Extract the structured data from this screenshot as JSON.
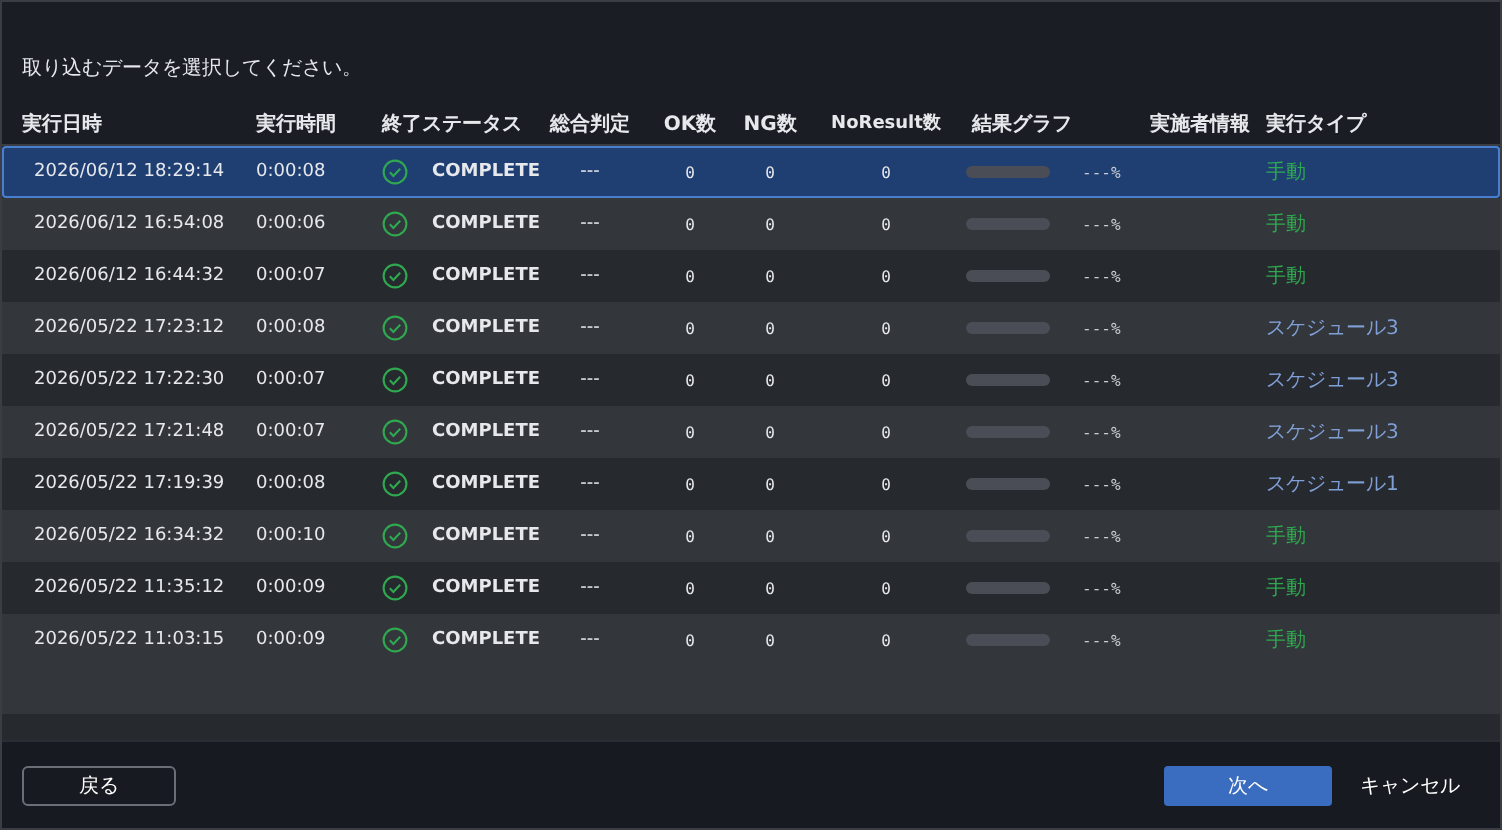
{
  "prompt": "取り込むデータを選択してください。",
  "columns": [
    "実行日時",
    "実行時間",
    "終了ステータス",
    "総合判定",
    "OK数",
    "NG数",
    "NoResult数",
    "結果グラフ",
    "実施者情報",
    "実行タイプ"
  ],
  "rows": [
    {
      "date": "2026/06/12 18:29:14",
      "time": "0:00:08",
      "status": "COMPLETE",
      "total": "---",
      "ok": "0",
      "ng": "0",
      "noresult": "0",
      "percent": "---%",
      "type": "手動",
      "kind": "manual",
      "selected": true
    },
    {
      "date": "2026/06/12 16:54:08",
      "time": "0:00:06",
      "status": "COMPLETE",
      "total": "---",
      "ok": "0",
      "ng": "0",
      "noresult": "0",
      "percent": "---%",
      "type": "手動",
      "kind": "manual",
      "selected": false
    },
    {
      "date": "2026/06/12 16:44:32",
      "time": "0:00:07",
      "status": "COMPLETE",
      "total": "---",
      "ok": "0",
      "ng": "0",
      "noresult": "0",
      "percent": "---%",
      "type": "手動",
      "kind": "manual",
      "selected": false
    },
    {
      "date": "2026/05/22 17:23:12",
      "time": "0:00:08",
      "status": "COMPLETE",
      "total": "---",
      "ok": "0",
      "ng": "0",
      "noresult": "0",
      "percent": "---%",
      "type": "スケジュール3",
      "kind": "schedule",
      "selected": false
    },
    {
      "date": "2026/05/22 17:22:30",
      "time": "0:00:07",
      "status": "COMPLETE",
      "total": "---",
      "ok": "0",
      "ng": "0",
      "noresult": "0",
      "percent": "---%",
      "type": "スケジュール3",
      "kind": "schedule",
      "selected": false
    },
    {
      "date": "2026/05/22 17:21:48",
      "time": "0:00:07",
      "status": "COMPLETE",
      "total": "---",
      "ok": "0",
      "ng": "0",
      "noresult": "0",
      "percent": "---%",
      "type": "スケジュール3",
      "kind": "schedule",
      "selected": false
    },
    {
      "date": "2026/05/22 17:19:39",
      "time": "0:00:08",
      "status": "COMPLETE",
      "total": "---",
      "ok": "0",
      "ng": "0",
      "noresult": "0",
      "percent": "---%",
      "type": "スケジュール1",
      "kind": "schedule",
      "selected": false
    },
    {
      "date": "2026/05/22 16:34:32",
      "time": "0:00:10",
      "status": "COMPLETE",
      "total": "---",
      "ok": "0",
      "ng": "0",
      "noresult": "0",
      "percent": "---%",
      "type": "手動",
      "kind": "manual",
      "selected": false
    },
    {
      "date": "2026/05/22 11:35:12",
      "time": "0:00:09",
      "status": "COMPLETE",
      "total": "---",
      "ok": "0",
      "ng": "0",
      "noresult": "0",
      "percent": "---%",
      "type": "手動",
      "kind": "manual",
      "selected": false
    },
    {
      "date": "2026/05/22 11:03:15",
      "time": "0:00:09",
      "status": "COMPLETE",
      "total": "---",
      "ok": "0",
      "ng": "0",
      "noresult": "0",
      "percent": "---%",
      "type": "手動",
      "kind": "manual",
      "selected": false
    }
  ],
  "buttons": {
    "back": "戻る",
    "next": "次へ",
    "cancel": "キャンセル"
  }
}
